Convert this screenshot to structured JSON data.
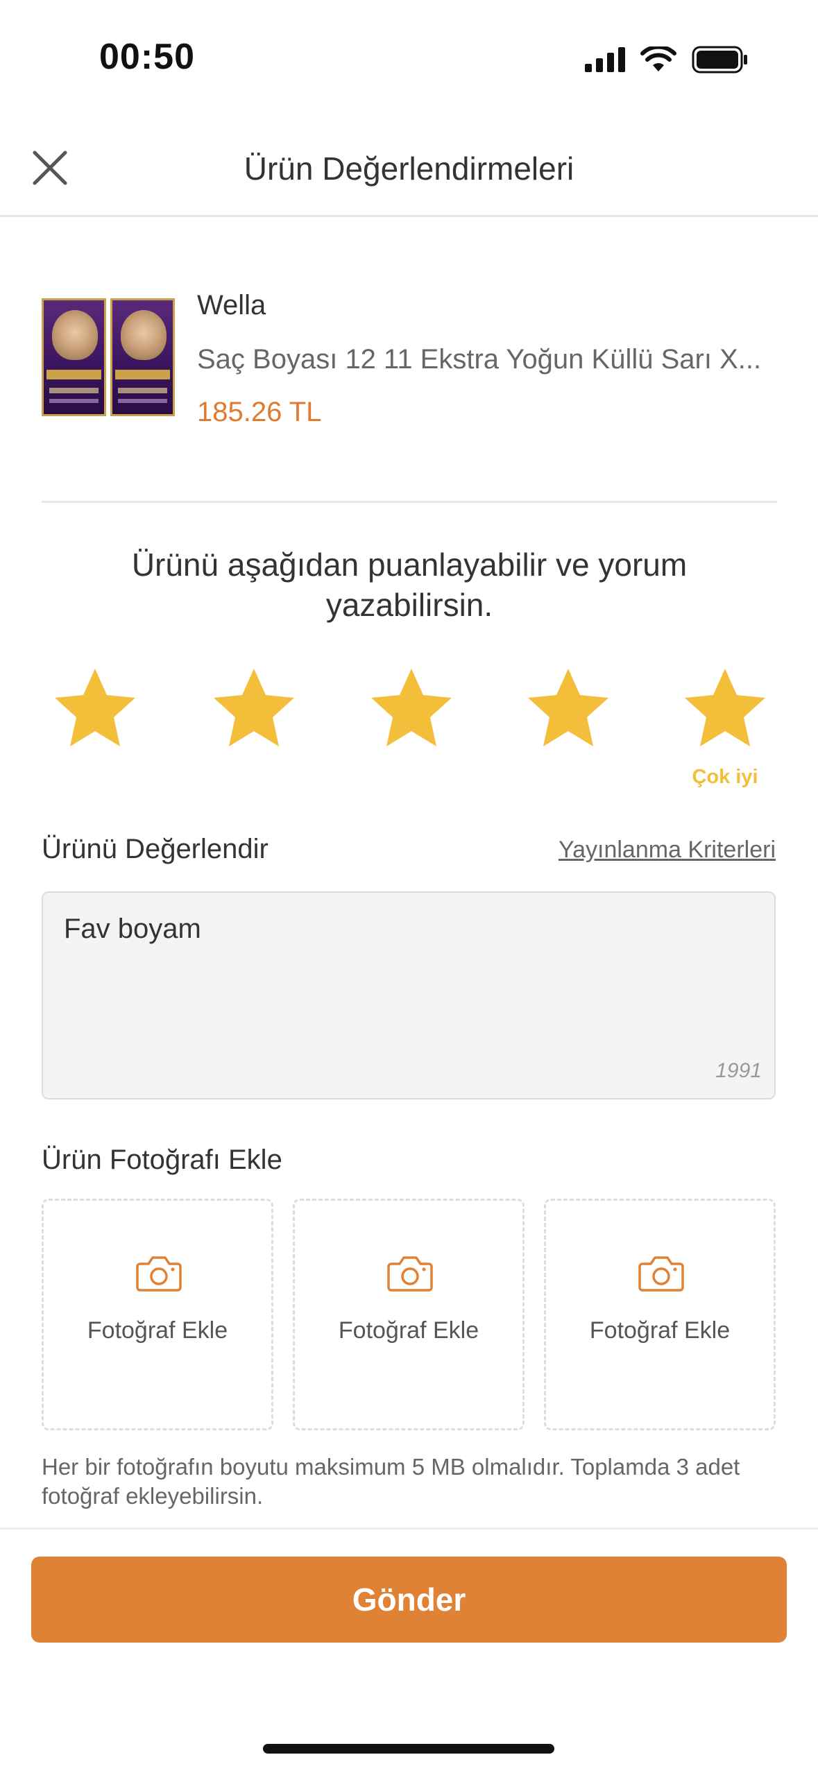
{
  "status_bar": {
    "time": "00:50"
  },
  "header": {
    "title": "Ürün Değerlendirmeleri"
  },
  "product": {
    "brand": "Wella",
    "name": "Saç Boyası 12 11 Ekstra Yoğun Küllü Sarı X...",
    "price": "185.26 TL"
  },
  "prompt": {
    "text": "Ürünü aşağıdan puanlayabilir ve yorum yazabilirsin."
  },
  "rating": {
    "value": 5,
    "max": 5,
    "label": "Çok iyi",
    "star_color": "#f3be3a"
  },
  "review": {
    "section_title": "Ürünü Değerlendir",
    "criteria_link": "Yayınlanma Kriterleri",
    "text": "Fav boyam",
    "char_count": "1991"
  },
  "photos": {
    "section_title": "Ürün Fotoğrafı Ekle",
    "slots": [
      "Fotoğraf Ekle",
      "Fotoğraf Ekle",
      "Fotoğraf Ekle"
    ],
    "note": "Her bir fotoğrafın boyutu maksimum 5 MB olmalıdır. Toplamda 3 adet fotoğraf ekleyebilirsin."
  },
  "submit": {
    "label": "Gönder"
  },
  "colors": {
    "accent": "#e08235",
    "price": "#e07a2f",
    "star": "#f3be3a"
  }
}
